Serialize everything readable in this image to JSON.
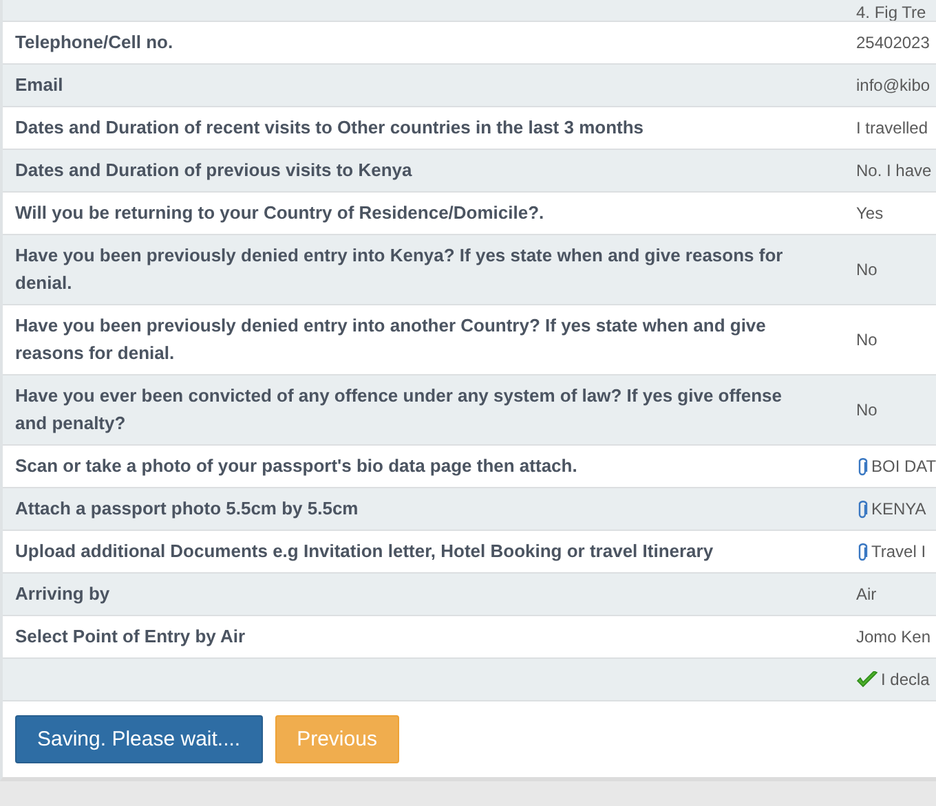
{
  "rows": [
    {
      "label": "",
      "value": "4. Fig Tre",
      "kind": "text",
      "partial": true
    },
    {
      "label": "Telephone/Cell no.",
      "value": "25402023",
      "kind": "text"
    },
    {
      "label": "Email",
      "value": "info@kibo",
      "kind": "text"
    },
    {
      "label": "Dates and Duration of recent visits to Other countries in the last 3 months",
      "value": "I travelled",
      "kind": "text"
    },
    {
      "label": "Dates and Duration of previous visits to Kenya",
      "value": "No. I have",
      "kind": "text"
    },
    {
      "label": "Will you be returning to your Country of Residence/Domicile?.",
      "value": "Yes",
      "kind": "text"
    },
    {
      "label": "Have you been previously denied entry into Kenya? If yes state when and give reasons for denial.",
      "value": "No",
      "kind": "text"
    },
    {
      "label": "Have you been previously denied entry into another Country? If yes state when and give reasons for denial.",
      "value": "No",
      "kind": "text"
    },
    {
      "label": "Have you ever been convicted of any offence under any system of law? If yes give offense and penalty?",
      "value": "No",
      "kind": "text"
    },
    {
      "label": "Scan or take a photo of your passport's bio data page then attach.",
      "value": "BOI DAT",
      "kind": "attachment"
    },
    {
      "label": "Attach a passport photo 5.5cm by 5.5cm",
      "value": "KENYA",
      "kind": "attachment"
    },
    {
      "label": "Upload additional Documents e.g Invitation letter, Hotel Booking or travel Itinerary",
      "value": "Travel I",
      "kind": "attachment"
    },
    {
      "label": "Arriving by",
      "value": "Air",
      "kind": "text"
    },
    {
      "label": "Select Point of Entry by Air",
      "value": "Jomo Ken",
      "kind": "text"
    },
    {
      "label": "",
      "value": "I decla",
      "kind": "declaration",
      "checked": true
    }
  ],
  "buttons": [
    {
      "label": "Saving. Please wait....",
      "kind": "primary"
    },
    {
      "label": "Previous",
      "kind": "warning"
    }
  ]
}
